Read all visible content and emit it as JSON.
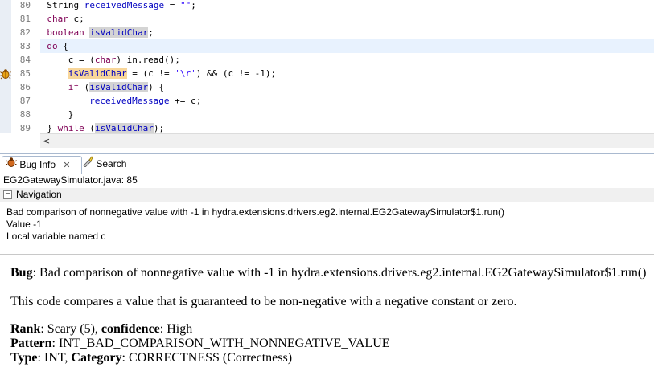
{
  "editor": {
    "current_line_index": 4,
    "lines": [
      {
        "num": "80",
        "indent": 24,
        "tokens": [
          {
            "t": "String ",
            "c": ""
          },
          {
            "t": "receivedMessage",
            "c": "fld"
          },
          {
            "t": " = ",
            "c": ""
          },
          {
            "t": "\"\"",
            "c": "str"
          },
          {
            "t": ";",
            "c": ""
          }
        ]
      },
      {
        "num": "81",
        "indent": 24,
        "tokens": [
          {
            "t": "char",
            "c": "kw"
          },
          {
            "t": " c;",
            "c": ""
          }
        ]
      },
      {
        "num": "82",
        "indent": 24,
        "tokens": [
          {
            "t": "boolean",
            "c": "kw"
          },
          {
            "t": " ",
            "c": ""
          },
          {
            "t": "isValidChar",
            "c": "fld occ"
          },
          {
            "t": ";",
            "c": ""
          }
        ]
      },
      {
        "num": "83",
        "indent": 24,
        "tokens": [
          {
            "t": "do",
            "c": "kw"
          },
          {
            "t": " {",
            "c": ""
          }
        ]
      },
      {
        "num": "84",
        "indent": 28,
        "tokens": [
          {
            "t": "c = (",
            "c": ""
          },
          {
            "t": "char",
            "c": "kw"
          },
          {
            "t": ") in.read();",
            "c": ""
          }
        ]
      },
      {
        "num": "85",
        "indent": 28,
        "tokens": [
          {
            "t": "isValidChar",
            "c": "fld occw"
          },
          {
            "t": " = (c != ",
            "c": ""
          },
          {
            "t": "'\\r'",
            "c": "str"
          },
          {
            "t": ") && (c != -1);",
            "c": ""
          }
        ]
      },
      {
        "num": "86",
        "indent": 28,
        "tokens": [
          {
            "t": "if",
            "c": "kw"
          },
          {
            "t": " (",
            "c": ""
          },
          {
            "t": "isValidChar",
            "c": "fld occ"
          },
          {
            "t": ") {",
            "c": ""
          }
        ]
      },
      {
        "num": "87",
        "indent": 32,
        "tokens": [
          {
            "t": "receivedMessage",
            "c": "fld"
          },
          {
            "t": " += c;",
            "c": ""
          }
        ]
      },
      {
        "num": "88",
        "indent": 28,
        "tokens": [
          {
            "t": "}",
            "c": ""
          }
        ]
      },
      {
        "num": "89",
        "indent": 24,
        "tokens": [
          {
            "t": "} ",
            "c": ""
          },
          {
            "t": "while",
            "c": "kw"
          },
          {
            "t": " (",
            "c": ""
          },
          {
            "t": "isValidChar",
            "c": "fld occ"
          },
          {
            "t": ");",
            "c": ""
          }
        ]
      }
    ],
    "gutter_marker": "bug-marker-icon",
    "hscroll_arrow": "<"
  },
  "tabs": [
    {
      "label": "Bug Info",
      "icon": "bug-icon",
      "active": true,
      "close": "✕"
    },
    {
      "label": "Search",
      "icon": "flashlight-icon",
      "active": false
    }
  ],
  "file_ref": "EG2GatewaySimulator.java: 85",
  "navigation": {
    "toggle": "−",
    "title": "Navigation",
    "items": [
      "Bad comparison of nonnegative value with -1 in hydra.extensions.drivers.eg2.internal.EG2GatewaySimulator$1.run()",
      "Value -1",
      "Local variable named c"
    ]
  },
  "details": {
    "bug_label": "Bug",
    "bug_text": ": Bad comparison of nonnegative value with -1 in hydra.extensions.drivers.eg2.internal.EG2GatewaySimulator$1.run()",
    "description": "This code compares a value that is guaranteed to be non-negative with a negative constant or zero.",
    "rank_label": "Rank",
    "rank_value": ": Scary (5), ",
    "confidence_label": "confidence",
    "confidence_value": ": High",
    "pattern_label": "Pattern",
    "pattern_value": ": INT_BAD_COMPARISON_WITH_NONNEGATIVE_VALUE",
    "type_label": "Type",
    "type_value": ": INT, ",
    "category_label": "Category",
    "category_value": ": CORRECTNESS (Correctness)"
  }
}
